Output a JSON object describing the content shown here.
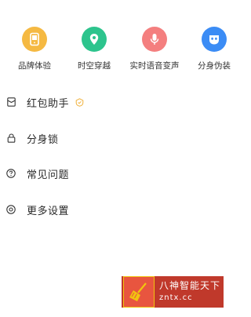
{
  "features": [
    {
      "label": "品牌体验",
      "icon": "phone-icon",
      "color": "#f5b942"
    },
    {
      "label": "时空穿越",
      "icon": "location-pin-icon",
      "color": "#2dc48d"
    },
    {
      "label": "实时语音变声",
      "icon": "microphone-icon",
      "color": "#f47f7f"
    },
    {
      "label": "分身伪装",
      "icon": "mask-icon",
      "color": "#3b8cf5"
    }
  ],
  "menu": [
    {
      "label": "红包助手",
      "icon": "red-envelope-icon",
      "badge": "shield-badge-icon"
    },
    {
      "label": "分身锁",
      "icon": "lock-icon"
    },
    {
      "label": "常见问题",
      "icon": "question-icon"
    },
    {
      "label": "更多设置",
      "icon": "settings-icon"
    }
  ],
  "watermark": {
    "title": "八神智能天下",
    "url": "zntx.cc"
  }
}
